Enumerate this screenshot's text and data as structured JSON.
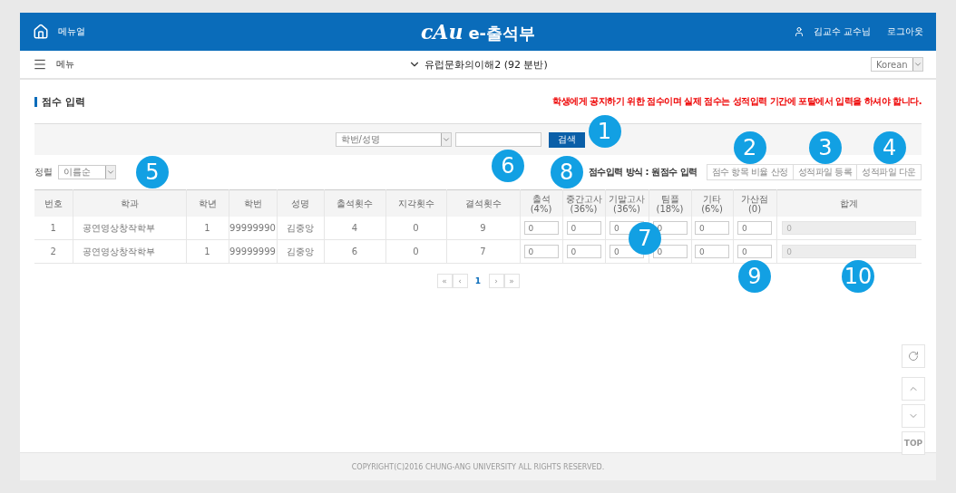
{
  "header": {
    "manual": "메뉴얼",
    "logo_mark": "cAu",
    "logo_text": "e-출석부",
    "user": "김교수 교수님",
    "logout": "로그아웃"
  },
  "nav": {
    "menu": "메뉴",
    "course": "유럽문화의이해2 (92 분반)",
    "language": "Korean"
  },
  "page": {
    "title": "점수 입력",
    "notice": "학생에게 공지하기 위한 점수이며 실제 점수는 성적입력 기간에 포탈에서 입력을 하셔야 합니다."
  },
  "search": {
    "field_select": "학번/성명",
    "button": "검색"
  },
  "sort": {
    "label": "정렬",
    "value": "이름순"
  },
  "input_mode": "점수입력 방식 : 원점수 입력",
  "actions": [
    "점수 항목 비율 산정",
    "성적파일 등록",
    "성적파일 다운"
  ],
  "table": {
    "columns": [
      "번호",
      "학과",
      "학년",
      "학번",
      "성명",
      "출석횟수",
      "지각횟수",
      "결석횟수",
      "출석\n(4%)",
      "중간고사\n(36%)",
      "기말고사\n(36%)",
      "팀플\n(18%)",
      "기타\n(6%)",
      "가산점\n(0)",
      "합계"
    ],
    "rows": [
      {
        "cells": [
          "1",
          "공연영상창작학부",
          "1",
          "99999990",
          "김중앙",
          "4",
          "0",
          "9"
        ],
        "scores": [
          "0",
          "0",
          "0",
          "0",
          "0",
          "0"
        ],
        "total": "0",
        "total_disabled": true
      },
      {
        "cells": [
          "2",
          "공연영상창작학부",
          "1",
          "99999999",
          "김중앙",
          "6",
          "0",
          "7"
        ],
        "scores": [
          "0",
          "0",
          "0",
          "0",
          "0",
          "0"
        ],
        "total": "0",
        "total_disabled": true
      }
    ]
  },
  "pagination": {
    "first": "«",
    "prev": "‹",
    "pages": [
      {
        "label": "1",
        "selected": true
      }
    ],
    "next": "›",
    "last": "»"
  },
  "side_buttons": {
    "top": "TOP"
  },
  "footer": "COPYRIGHT(C)2016 CHUNG-ANG UNIVERSITY ALL RIGHTS RESERVED.",
  "markers": [
    "1",
    "2",
    "3",
    "4",
    "5",
    "6",
    "7",
    "8",
    "9",
    "10"
  ]
}
